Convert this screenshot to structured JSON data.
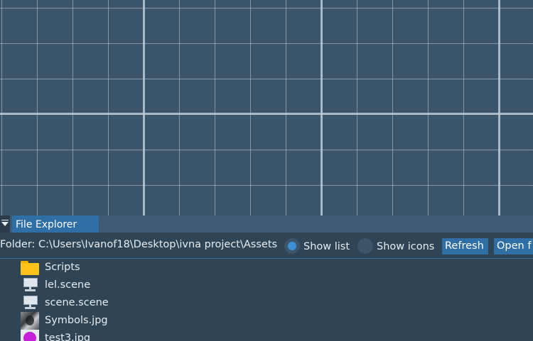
{
  "dock": {
    "tab_label": "File Explorer"
  },
  "toolbar": {
    "folder_label": "Folder: C:\\Users\\Ivanof18\\Desktop\\ivna project\\Assets",
    "show_list_label": "Show list",
    "show_icons_label": "Show icons",
    "view_mode": "list",
    "refresh_label": "Refresh",
    "open_folder_label": "Open f"
  },
  "files": [
    {
      "name": "Scripts",
      "icon": "folder-icon"
    },
    {
      "name": "lel.scene",
      "icon": "scene-file-icon"
    },
    {
      "name": "scene.scene",
      "icon": "scene-file-icon"
    },
    {
      "name": "Symbols.jpg",
      "icon": "image-thumbnail-icon"
    },
    {
      "name": "test3.jpg",
      "icon": "image-thumbnail-icon"
    }
  ],
  "colors": {
    "viewport_bg": "#3b556a",
    "panel_bg": "#2f4556",
    "accent": "#2f6fa6",
    "radio_checked": "#3d8fd6",
    "folder": "#ffc31a"
  }
}
